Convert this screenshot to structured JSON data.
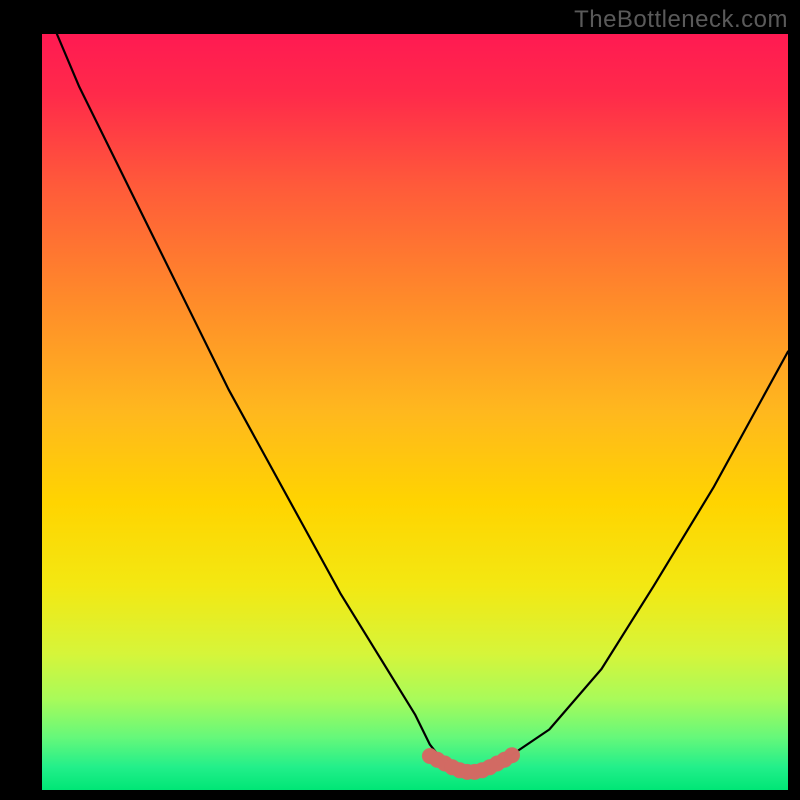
{
  "watermark": "TheBottleneck.com",
  "colors": {
    "frame": "#000000",
    "curve": "#000000",
    "marker": "#d26a63",
    "green": "#00e676",
    "red_top": "#ff1a52",
    "yellow_mid": "#ffd400"
  },
  "chart_data": {
    "type": "line",
    "title": "",
    "xlabel": "",
    "ylabel": "",
    "xlim": [
      0,
      100
    ],
    "ylim": [
      0,
      100
    ],
    "series": [
      {
        "name": "bottleneck-curve",
        "x": [
          2,
          5,
          10,
          15,
          20,
          25,
          30,
          35,
          40,
          45,
          50,
          52,
          54,
          56,
          58,
          60,
          62,
          68,
          75,
          82,
          90,
          100
        ],
        "values": [
          100,
          93,
          83,
          73,
          63,
          53,
          44,
          35,
          26,
          18,
          10,
          6,
          3.5,
          2.5,
          2.5,
          2.8,
          4,
          8,
          16,
          27,
          40,
          58
        ]
      }
    ],
    "highlight": {
      "name": "optimum-band",
      "x": [
        52,
        53,
        54,
        55,
        56,
        57,
        58,
        59,
        60,
        61,
        62,
        63
      ],
      "values": [
        4.5,
        4.0,
        3.5,
        3.0,
        2.6,
        2.4,
        2.4,
        2.6,
        3.0,
        3.5,
        4.0,
        4.6
      ]
    }
  }
}
